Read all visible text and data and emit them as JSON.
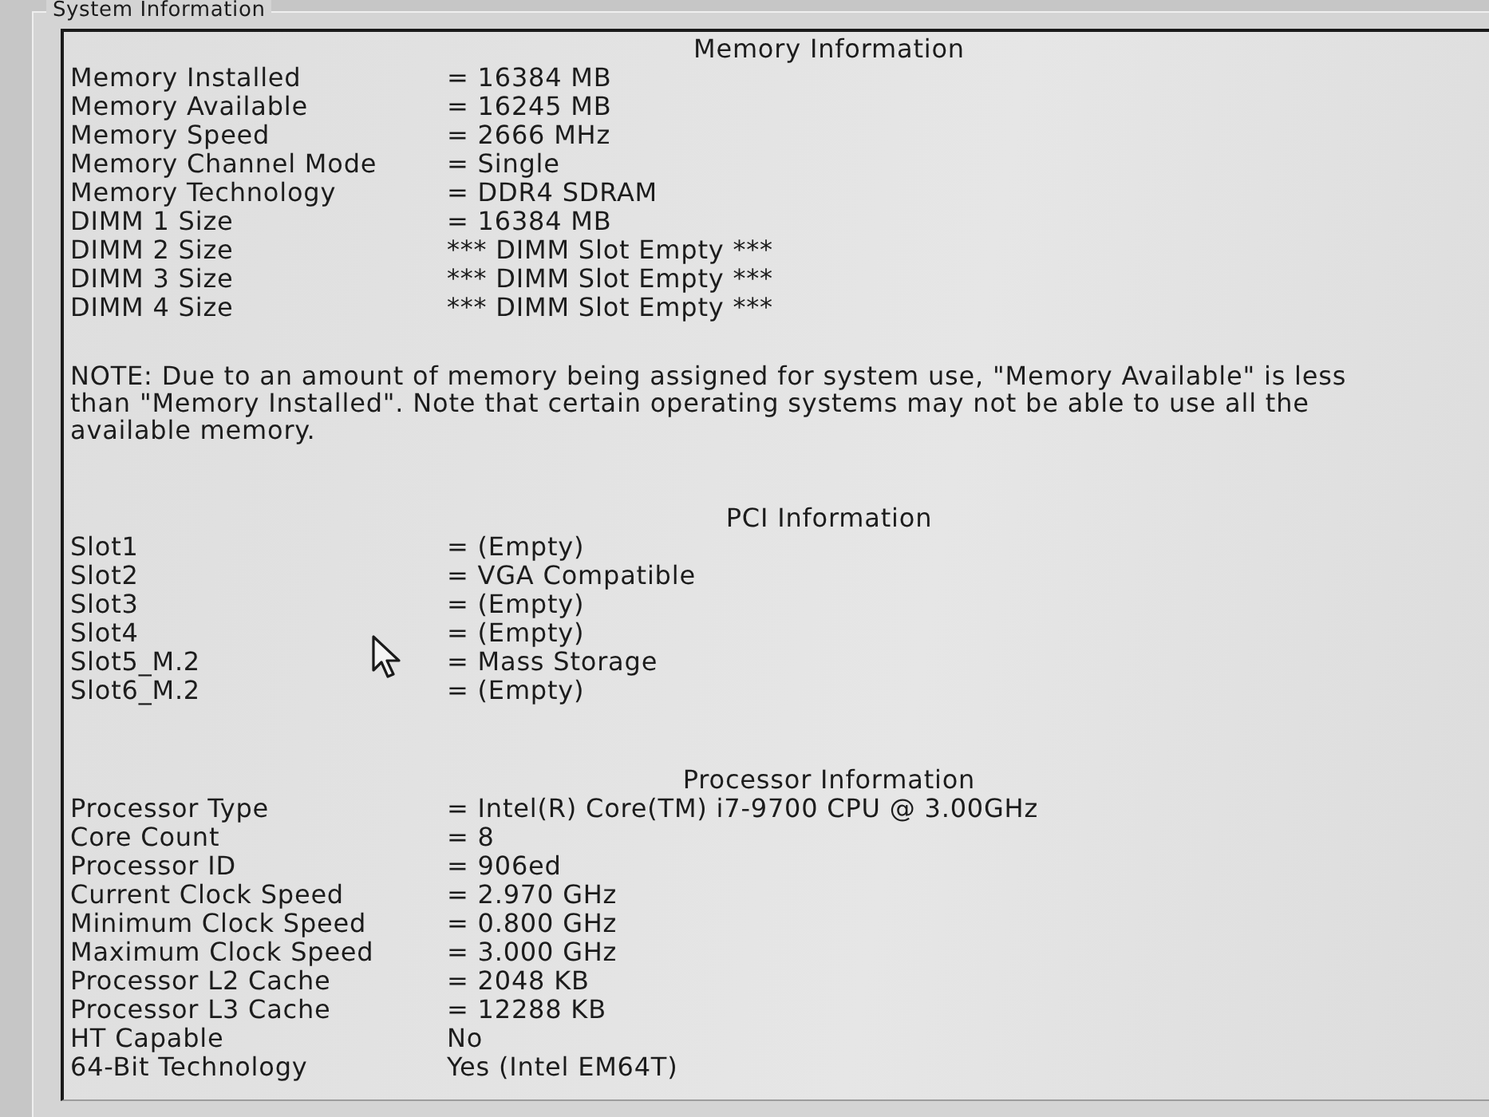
{
  "group": {
    "title": "System Information"
  },
  "sections": [
    {
      "title": "Memory Information",
      "rows": [
        {
          "label": "Memory Installed",
          "value": "= 16384 MB"
        },
        {
          "label": "Memory Available",
          "value": "= 16245 MB"
        },
        {
          "label": "Memory Speed",
          "value": "= 2666 MHz"
        },
        {
          "label": "Memory Channel Mode",
          "value": "= Single"
        },
        {
          "label": "Memory Technology",
          "value": "= DDR4 SDRAM"
        },
        {
          "label": "DIMM 1 Size",
          "value": "= 16384 MB"
        },
        {
          "label": "DIMM 2 Size",
          "value": "*** DIMM Slot Empty ***"
        },
        {
          "label": "DIMM 3 Size",
          "value": "*** DIMM Slot Empty ***"
        },
        {
          "label": "DIMM 4 Size",
          "value": "*** DIMM Slot Empty ***"
        }
      ],
      "note": "NOTE: Due to an amount of memory being assigned for system use, \"Memory Available\" is less than \"Memory Installed\". Note that certain operating systems may not be able to use all the available memory."
    },
    {
      "title": "PCI Information",
      "rows": [
        {
          "label": "Slot1",
          "value": "= (Empty)"
        },
        {
          "label": "Slot2",
          "value": "= VGA Compatible"
        },
        {
          "label": "Slot3",
          "value": "= (Empty)"
        },
        {
          "label": "Slot4",
          "value": "= (Empty)"
        },
        {
          "label": "Slot5_M.2",
          "value": "= Mass Storage"
        },
        {
          "label": "Slot6_M.2",
          "value": "= (Empty)"
        }
      ]
    },
    {
      "title": "Processor Information",
      "rows": [
        {
          "label": "Processor Type",
          "value": "= Intel(R) Core(TM) i7-9700 CPU @ 3.00GHz"
        },
        {
          "label": "Core Count",
          "value": "= 8"
        },
        {
          "label": "Processor ID",
          "value": "= 906ed"
        },
        {
          "label": "Current Clock Speed",
          "value": "= 2.970 GHz"
        },
        {
          "label": "Minimum Clock Speed",
          "value": "= 0.800 GHz"
        },
        {
          "label": "Maximum Clock Speed",
          "value": "= 3.000 GHz"
        },
        {
          "label": "Processor L2 Cache",
          "value": "= 2048 KB"
        },
        {
          "label": "Processor L3 Cache",
          "value": "= 12288 KB"
        },
        {
          "label": "HT Capable",
          "value": "No"
        },
        {
          "label": "64-Bit Technology",
          "value": "Yes (Intel EM64T)"
        }
      ]
    }
  ]
}
